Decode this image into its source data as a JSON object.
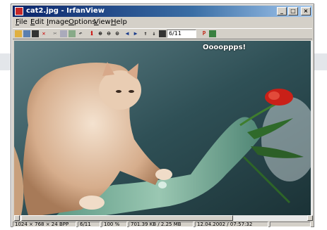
{
  "window": {
    "title": "cat2.jpg - IrfanView",
    "controls": {
      "minimize": "_",
      "maximize": "□",
      "close": "×"
    }
  },
  "menu": [
    "File",
    "Edit",
    "Image",
    "Options",
    "View",
    "Help"
  ],
  "toolbar": {
    "icons": [
      "open-folder-icon",
      "thumbnails-icon",
      "save-icon",
      "delete-icon",
      "cut-icon",
      "copy-icon",
      "paste-icon",
      "undo-icon",
      "info-icon",
      "zoom-in-icon",
      "zoom-out-icon",
      "prev-icon",
      "next-icon",
      "first-icon",
      "last-icon"
    ],
    "page_value": "6/11"
  },
  "image": {
    "caption": "Ooooppps!"
  },
  "status": {
    "dimensions": "1024 × 768 × 24 BPP",
    "page": "6/11",
    "zoom": "100 %",
    "size": "701.39 KB / 2.25 MB",
    "datetime": "12.04.2002 / 07:57:32"
  },
  "colors": {
    "title_start": "#0a246a",
    "title_end": "#a6caf0",
    "chrome": "#d4d0c8"
  }
}
